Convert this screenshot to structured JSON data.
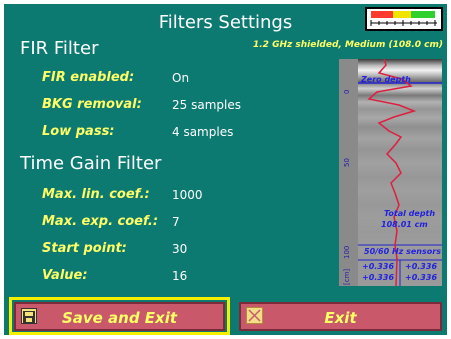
{
  "header": {
    "title": "Filters Settings",
    "antenna_info": "1.2 GHz shielded, Medium (108.0 cm)"
  },
  "fir": {
    "heading": "FIR Filter",
    "rows": [
      {
        "label": "FIR enabled:",
        "value": "On"
      },
      {
        "label": "BKG removal:",
        "value": "25 samples"
      },
      {
        "label": "Low pass:",
        "value": "4 samples"
      }
    ]
  },
  "tgf": {
    "heading": "Time Gain Filter",
    "rows": [
      {
        "label": "Max. lin. coef.:",
        "value": "1000"
      },
      {
        "label": "Max. exp. coef.:",
        "value": "7"
      },
      {
        "label": "Start point:",
        "value": "30"
      },
      {
        "label": "Value:",
        "value": "16"
      }
    ]
  },
  "preview": {
    "zero_depth": "Zero depth",
    "total_depth_label": "Total depth",
    "total_depth_value": "108.01 cm",
    "sensors_label": "50/60 Hz sensors",
    "readings": [
      "+0.336",
      "+0.336",
      "+0.336",
      "+0.336"
    ],
    "depth_ticks": [
      "0",
      "50",
      "100"
    ],
    "unit": "[cm]"
  },
  "buttons": {
    "save_label": "Save and Exit",
    "exit_label": "Exit"
  },
  "colors": {
    "background": "#0d7a72",
    "label": "#ffff66",
    "button": "#c8586a",
    "focus": "#f5f000"
  },
  "icons": {
    "save": "floppy-disk-icon",
    "exit": "close-box-icon",
    "status": "battery-level-icon"
  }
}
